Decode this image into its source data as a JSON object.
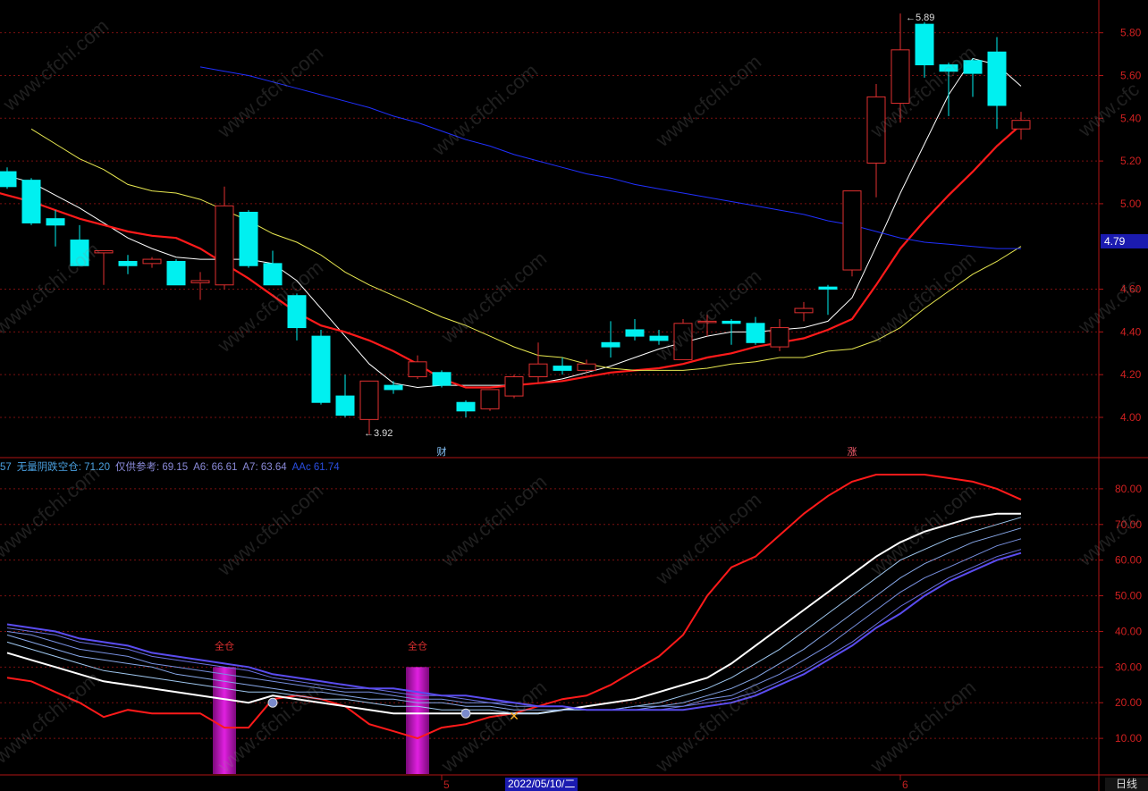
{
  "window": {
    "top_left_text": "",
    "period_button": "日线",
    "selected_date": "2022/05/10/二"
  },
  "price_panel": {
    "current_price_tag": "4.79",
    "high_annotation": "5.89",
    "low_annotation": "3.92",
    "event_markers": [
      {
        "label": "财"
      },
      {
        "label": "涨"
      }
    ],
    "y_ticks": [
      "5.80",
      "5.60",
      "5.40",
      "5.20",
      "5.00",
      "4.60",
      "4.40",
      "4.20",
      "4.00"
    ]
  },
  "indicator_panel": {
    "legend": [
      {
        "label": "57",
        "color": "#4aa0e0"
      },
      {
        "label": "无量阴跌空仓: 71.20",
        "color": "#4aa0e0"
      },
      {
        "label": "仅供参考: 69.15",
        "color": "#8a8ad8"
      },
      {
        "label": "A6: 66.61",
        "color": "#8a8ad8"
      },
      {
        "label": "A7: 63.64",
        "color": "#8a8ad8"
      },
      {
        "label": "AAc 61.74",
        "color": "#2a4ee0"
      }
    ],
    "y_ticks": [
      "80.00",
      "70.00",
      "60.00",
      "50.00",
      "40.00",
      "30.00",
      "20.00",
      "10.00"
    ],
    "signals": [
      {
        "label": "全仓"
      },
      {
        "label": "全仓"
      }
    ]
  },
  "x_axis": {
    "labels": [
      "5",
      "6"
    ]
  },
  "colors": {
    "up": "#e03030",
    "down": "#00f0f0",
    "ma5": "#ffffff",
    "ma10": "#ff1a1a",
    "ma20": "#e8e850",
    "ma60": "#2030ff",
    "bar": "#e020e0",
    "grid": "#7a1010"
  },
  "chart_data": [
    {
      "type": "candlestick",
      "title": "",
      "ylim": [
        3.82,
        5.92
      ],
      "candles": [
        {
          "o": 5.15,
          "h": 5.17,
          "l": 5.07,
          "c": 5.08
        },
        {
          "o": 5.11,
          "h": 5.12,
          "l": 4.9,
          "c": 4.91
        },
        {
          "o": 4.93,
          "h": 4.97,
          "l": 4.8,
          "c": 4.9
        },
        {
          "o": 4.83,
          "h": 4.9,
          "l": 4.71,
          "c": 4.71
        },
        {
          "o": 4.77,
          "h": 4.78,
          "l": 4.62,
          "c": 4.78
        },
        {
          "o": 4.73,
          "h": 4.76,
          "l": 4.67,
          "c": 4.71
        },
        {
          "o": 4.72,
          "h": 4.75,
          "l": 4.7,
          "c": 4.74
        },
        {
          "o": 4.73,
          "h": 4.74,
          "l": 4.62,
          "c": 4.62
        },
        {
          "o": 4.63,
          "h": 4.68,
          "l": 4.55,
          "c": 4.64
        },
        {
          "o": 4.62,
          "h": 5.08,
          "l": 4.6,
          "c": 4.99
        },
        {
          "o": 4.96,
          "h": 4.97,
          "l": 4.7,
          "c": 4.71
        },
        {
          "o": 4.72,
          "h": 4.78,
          "l": 4.62,
          "c": 4.62
        },
        {
          "o": 4.57,
          "h": 4.58,
          "l": 4.36,
          "c": 4.42
        },
        {
          "o": 4.38,
          "h": 4.41,
          "l": 4.06,
          "c": 4.07
        },
        {
          "o": 4.1,
          "h": 4.2,
          "l": 4.0,
          "c": 4.01
        },
        {
          "o": 3.99,
          "h": 4.17,
          "l": 3.92,
          "c": 4.17
        },
        {
          "o": 4.15,
          "h": 4.17,
          "l": 4.11,
          "c": 4.13
        },
        {
          "o": 4.19,
          "h": 4.29,
          "l": 4.18,
          "c": 4.26
        },
        {
          "o": 4.21,
          "h": 4.22,
          "l": 4.14,
          "c": 4.15
        },
        {
          "o": 4.07,
          "h": 4.08,
          "l": 4.0,
          "c": 4.03
        },
        {
          "o": 4.04,
          "h": 4.13,
          "l": 4.03,
          "c": 4.13
        },
        {
          "o": 4.1,
          "h": 4.2,
          "l": 4.09,
          "c": 4.19
        },
        {
          "o": 4.19,
          "h": 4.35,
          "l": 4.16,
          "c": 4.25
        },
        {
          "o": 4.24,
          "h": 4.28,
          "l": 4.2,
          "c": 4.22
        },
        {
          "o": 4.22,
          "h": 4.27,
          "l": 4.21,
          "c": 4.25
        },
        {
          "o": 4.35,
          "h": 4.45,
          "l": 4.28,
          "c": 4.33
        },
        {
          "o": 4.41,
          "h": 4.46,
          "l": 4.36,
          "c": 4.38
        },
        {
          "o": 4.38,
          "h": 4.41,
          "l": 4.34,
          "c": 4.36
        },
        {
          "o": 4.27,
          "h": 4.46,
          "l": 4.27,
          "c": 4.44
        },
        {
          "o": 4.45,
          "h": 4.48,
          "l": 4.38,
          "c": 4.45
        },
        {
          "o": 4.45,
          "h": 4.46,
          "l": 4.34,
          "c": 4.44
        },
        {
          "o": 4.44,
          "h": 4.47,
          "l": 4.34,
          "c": 4.35
        },
        {
          "o": 4.33,
          "h": 4.46,
          "l": 4.31,
          "c": 4.42
        },
        {
          "o": 4.49,
          "h": 4.54,
          "l": 4.45,
          "c": 4.51
        },
        {
          "o": 4.61,
          "h": 4.62,
          "l": 4.48,
          "c": 4.6
        },
        {
          "o": 4.69,
          "h": 5.06,
          "l": 4.66,
          "c": 5.06
        },
        {
          "o": 5.19,
          "h": 5.56,
          "l": 5.03,
          "c": 5.5
        },
        {
          "o": 5.47,
          "h": 5.89,
          "l": 5.38,
          "c": 5.72
        },
        {
          "o": 5.84,
          "h": 5.85,
          "l": 5.59,
          "c": 5.65
        },
        {
          "o": 5.65,
          "h": 5.66,
          "l": 5.41,
          "c": 5.62
        },
        {
          "o": 5.67,
          "h": 5.68,
          "l": 5.5,
          "c": 5.61
        },
        {
          "o": 5.71,
          "h": 5.78,
          "l": 5.35,
          "c": 5.46
        },
        {
          "o": 5.35,
          "h": 5.43,
          "l": 5.3,
          "c": 5.39
        }
      ],
      "series": [
        {
          "values": [
            5.13,
            5.1,
            5.04,
            4.98,
            4.91,
            4.84,
            4.79,
            4.75,
            4.74,
            4.74,
            4.74,
            4.72,
            4.64,
            4.51,
            4.38,
            4.25,
            4.16,
            4.14,
            4.15,
            4.15,
            4.15,
            4.15,
            4.16,
            4.18,
            4.21,
            4.24,
            4.28,
            4.32,
            4.35,
            4.38,
            4.4,
            4.4,
            4.41,
            4.42,
            4.45,
            4.56,
            4.8,
            5.05,
            5.28,
            5.51,
            5.68,
            5.65,
            5.55
          ]
        },
        {
          "values": [
            5.14,
            5.12,
            5.09,
            5.07,
            5.04,
            5.01,
            4.97,
            4.93,
            4.9,
            4.87,
            4.85,
            4.84,
            4.79,
            4.72,
            4.65,
            4.57,
            4.49,
            4.43,
            4.4,
            4.36,
            4.31,
            4.25,
            4.18,
            4.14,
            4.14,
            4.15,
            4.16,
            4.17,
            4.19,
            4.21,
            4.22,
            4.23,
            4.25,
            4.28,
            4.3,
            4.33,
            4.35,
            4.37,
            4.41,
            4.46,
            4.62,
            4.79,
            4.92,
            5.04,
            5.15,
            5.27,
            5.37
          ]
        },
        {
          "values": [
            5.35,
            5.28,
            5.21,
            5.16,
            5.09,
            5.06,
            5.05,
            5.02,
            4.97,
            4.92,
            4.86,
            4.82,
            4.76,
            4.68,
            4.62,
            4.57,
            4.52,
            4.47,
            4.43,
            4.38,
            4.33,
            4.29,
            4.28,
            4.25,
            4.23,
            4.22,
            4.22,
            4.22,
            4.23,
            4.25,
            4.26,
            4.28,
            4.28,
            4.31,
            4.32,
            4.36,
            4.42,
            4.51,
            4.59,
            4.67,
            4.73,
            4.8
          ]
        },
        {
          "values": [
            5.64,
            5.62,
            5.6,
            5.57,
            5.54,
            5.51,
            5.48,
            5.45,
            5.41,
            5.38,
            5.34,
            5.3,
            5.27,
            5.23,
            5.2,
            5.17,
            5.14,
            5.12,
            5.09,
            5.07,
            5.05,
            5.03,
            5.01,
            4.99,
            4.97,
            4.95,
            4.92,
            4.9,
            4.87,
            4.84,
            4.82,
            4.81,
            4.8,
            4.79,
            4.79
          ]
        }
      ]
    },
    {
      "type": "line",
      "title": "",
      "ylim": [
        0,
        88
      ],
      "series": [
        {
          "values": [
            27,
            26,
            23,
            20,
            16,
            18,
            17,
            17,
            17,
            13,
            13,
            21,
            22,
            21,
            19,
            14,
            12,
            10,
            13,
            14,
            16,
            17,
            19,
            21,
            22,
            25,
            29,
            33,
            39,
            50,
            58,
            61,
            67,
            73,
            78,
            82,
            84,
            84,
            84,
            83,
            82,
            80,
            77
          ]
        },
        {
          "values": [
            34,
            32,
            30,
            28,
            26,
            25,
            24,
            23,
            22,
            21,
            20,
            22,
            21,
            20,
            19,
            18,
            17,
            17,
            17,
            17,
            17,
            17,
            17,
            18,
            19,
            20,
            21,
            23,
            25,
            27,
            31,
            36,
            41,
            46,
            51,
            56,
            61,
            65,
            68,
            70,
            72,
            73,
            73
          ]
        },
        {
          "values": [
            37,
            35,
            33,
            31,
            29,
            28,
            27,
            26,
            25,
            24,
            23,
            23,
            22,
            21,
            21,
            20,
            19,
            19,
            18,
            18,
            18,
            17,
            17,
            18,
            18,
            18,
            19,
            20,
            22,
            24,
            27,
            31,
            35,
            40,
            45,
            50,
            55,
            60,
            63,
            66,
            68,
            70,
            72
          ]
        },
        {
          "values": [
            39,
            37,
            35,
            33,
            32,
            31,
            30,
            28,
            27,
            26,
            25,
            24,
            23,
            23,
            22,
            21,
            21,
            20,
            20,
            19,
            19,
            18,
            18,
            18,
            18,
            18,
            19,
            19,
            20,
            22,
            24,
            27,
            31,
            35,
            40,
            45,
            50,
            55,
            59,
            62,
            65,
            67,
            69
          ]
        },
        {
          "values": [
            40,
            39,
            37,
            35,
            34,
            33,
            31,
            30,
            29,
            28,
            27,
            26,
            25,
            24,
            23,
            23,
            22,
            21,
            21,
            20,
            20,
            19,
            19,
            19,
            18,
            18,
            18,
            19,
            19,
            21,
            22,
            25,
            28,
            32,
            36,
            41,
            46,
            51,
            55,
            58,
            61,
            64,
            66
          ]
        },
        {
          "values": [
            41,
            40,
            39,
            37,
            36,
            35,
            33,
            32,
            31,
            30,
            29,
            27,
            26,
            25,
            24,
            24,
            23,
            22,
            22,
            21,
            20,
            20,
            19,
            19,
            18,
            18,
            18,
            18,
            19,
            20,
            21,
            23,
            26,
            29,
            33,
            37,
            42,
            47,
            51,
            55,
            58,
            61,
            63
          ]
        },
        {
          "values": [
            42,
            41,
            40,
            38,
            37,
            36,
            34,
            33,
            32,
            31,
            30,
            28,
            27,
            26,
            25,
            24,
            24,
            23,
            22,
            22,
            21,
            20,
            19,
            19,
            18,
            18,
            18,
            18,
            18,
            19,
            20,
            22,
            25,
            28,
            32,
            36,
            41,
            45,
            50,
            54,
            57,
            60,
            62
          ]
        }
      ],
      "bars": [
        {
          "index": 9,
          "from": 0,
          "to": 30
        },
        {
          "index": 17,
          "from": 0,
          "to": 30
        }
      ]
    }
  ]
}
